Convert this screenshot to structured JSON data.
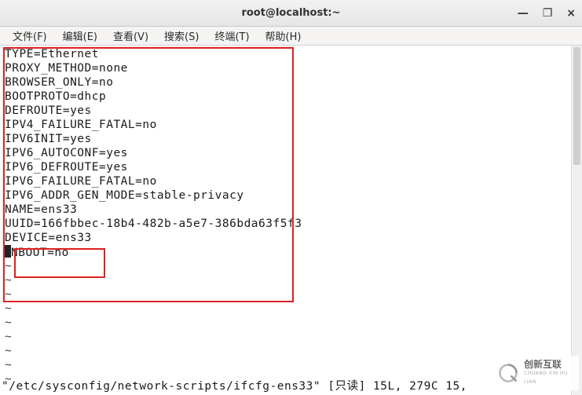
{
  "window": {
    "title": "root@localhost:~",
    "controls": {
      "min": "—",
      "max": "❐",
      "close": "×"
    }
  },
  "menubar": [
    {
      "label": "文件(F)"
    },
    {
      "label": "编辑(E)"
    },
    {
      "label": "查看(V)"
    },
    {
      "label": "搜索(S)"
    },
    {
      "label": "终端(T)"
    },
    {
      "label": "帮助(H)"
    }
  ],
  "file_content": [
    "TYPE=Ethernet",
    "PROXY_METHOD=none",
    "BROWSER_ONLY=no",
    "BOOTPROTO=dhcp",
    "DEFROUTE=yes",
    "IPV4_FAILURE_FATAL=no",
    "IPV6INIT=yes",
    "IPV6_AUTOCONF=yes",
    "IPV6_DEFROUTE=yes",
    "IPV6_FAILURE_FATAL=no",
    "IPV6_ADDR_GEN_MODE=stable-privacy",
    "NAME=ens33",
    "UUID=166fbbec-18b4-482b-a5e7-386bda63f5f3",
    "DEVICE=ens33"
  ],
  "last_line": {
    "before_cursor": "",
    "cursor_char": "O",
    "after_cursor": "NBOOT=no"
  },
  "tilde_count": 9,
  "status_line": "\"/etc/sysconfig/network-scripts/ifcfg-ens33\" [只读] 15L, 279C 15,",
  "watermark": {
    "brand_cn": "创新互联",
    "brand_pinyin": "CHUANG XIN HU LIAN"
  }
}
